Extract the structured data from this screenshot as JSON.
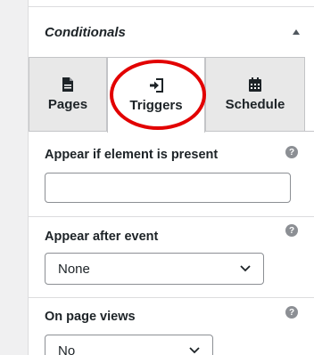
{
  "panel": {
    "title": "Conditionals",
    "tabs": [
      {
        "label": "Pages",
        "icon": "document-icon"
      },
      {
        "label": "Triggers",
        "icon": "sign-in-icon",
        "active": true
      },
      {
        "label": "Schedule",
        "icon": "calendar-icon"
      }
    ]
  },
  "fields": {
    "element_present": {
      "label": "Appear if element is present",
      "value": "",
      "help": "?"
    },
    "after_event": {
      "label": "Appear after event",
      "value": "None",
      "help": "?"
    },
    "page_views": {
      "label": "On page views",
      "value": "No",
      "help": "?"
    }
  },
  "colors": {
    "highlight": "#e20000",
    "accent_text": "#1d2327"
  }
}
